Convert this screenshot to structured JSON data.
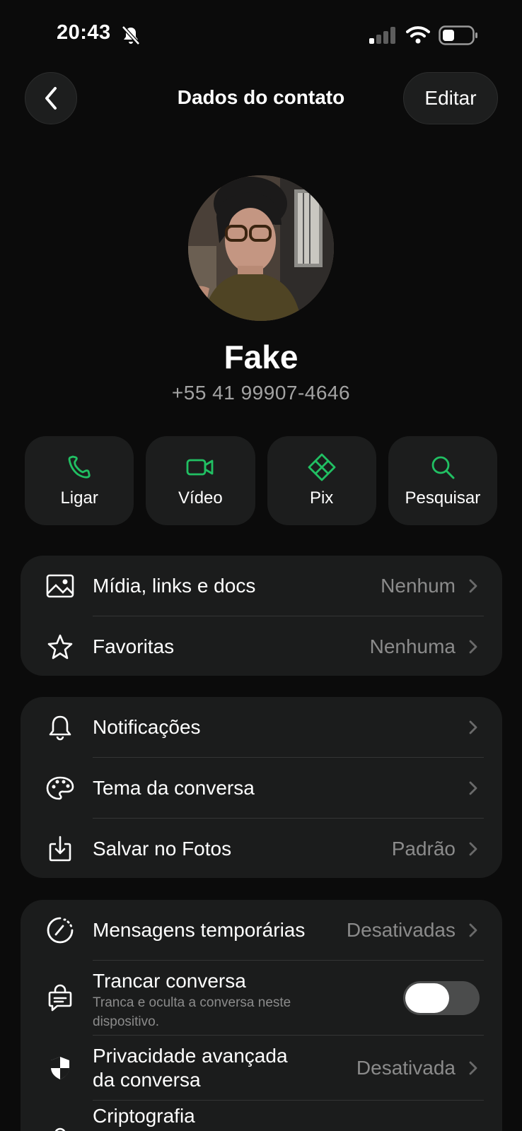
{
  "status_bar": {
    "time": "20:43"
  },
  "header": {
    "title": "Dados do contato",
    "edit_label": "Editar"
  },
  "contact": {
    "name": "Fake",
    "phone": "+55 41 99907-4646"
  },
  "actions": [
    {
      "label": "Ligar",
      "icon": "phone-icon"
    },
    {
      "label": "Vídeo",
      "icon": "video-icon"
    },
    {
      "label": "Pix",
      "icon": "pix-icon"
    },
    {
      "label": "Pesquisar",
      "icon": "search-icon"
    }
  ],
  "group1": [
    {
      "label": "Mídia, links e docs",
      "value": "Nenhum",
      "icon": "image-icon"
    },
    {
      "label": "Favoritas",
      "value": "Nenhuma",
      "icon": "star-icon"
    }
  ],
  "group2": [
    {
      "label": "Notificações",
      "value": "",
      "icon": "bell-icon"
    },
    {
      "label": "Tema da conversa",
      "value": "",
      "icon": "palette-icon"
    },
    {
      "label": "Salvar no Fotos",
      "value": "Padrão",
      "icon": "save-photos-icon"
    }
  ],
  "group3": {
    "disappearing": {
      "label": "Mensagens temporárias",
      "value": "Desativadas"
    },
    "lock": {
      "label": "Trancar conversa",
      "sublabel": "Tranca e oculta a conversa neste dispositivo.",
      "enabled": false
    },
    "privacy": {
      "label": "Privacidade avançada da conversa",
      "value": "Desativada"
    },
    "encryption": {
      "label": "Criptografia"
    }
  },
  "colors": {
    "accent": "#21c063",
    "background": "#0b0b0b",
    "card": "#1b1c1c"
  }
}
